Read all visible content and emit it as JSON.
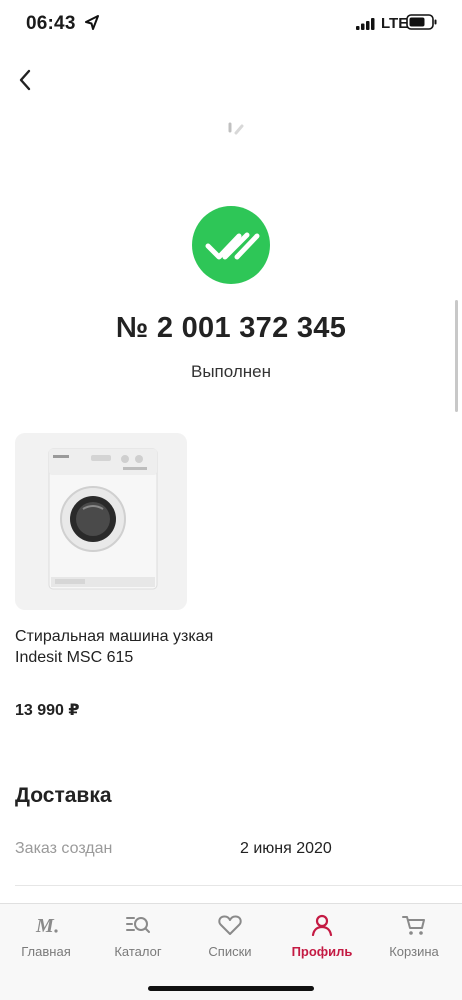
{
  "status_bar": {
    "time": "06:43",
    "network": "LTE"
  },
  "order": {
    "number": "№ 2 001 372 345",
    "status": "Выполнен"
  },
  "product": {
    "name": "Стиральная машина узкая Indesit MSC 615",
    "price": "13 990 ₽"
  },
  "delivery": {
    "title": "Доставка",
    "rows": [
      {
        "label": "Заказ создан",
        "value": "2 июня 2020"
      }
    ]
  },
  "tab_bar": {
    "items": [
      {
        "label": "Главная",
        "icon": "brand-m-icon",
        "active": false
      },
      {
        "label": "Каталог",
        "icon": "catalog-search-icon",
        "active": false
      },
      {
        "label": "Списки",
        "icon": "heart-icon",
        "active": false
      },
      {
        "label": "Профиль",
        "icon": "profile-icon",
        "active": true
      },
      {
        "label": "Корзина",
        "icon": "cart-icon",
        "active": false
      }
    ]
  },
  "colors": {
    "success": "#2ec657",
    "accent": "#c41a43",
    "inactive": "#7a7a7a"
  }
}
